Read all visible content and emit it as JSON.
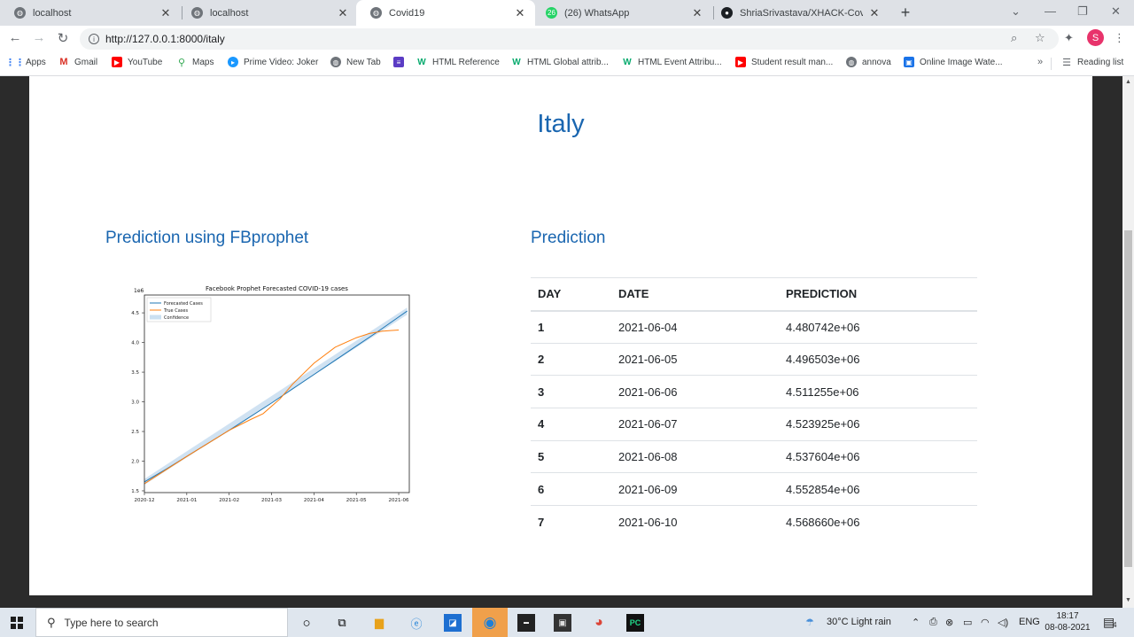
{
  "browser": {
    "tabs": [
      {
        "title": "localhost",
        "icon": "globe-icon",
        "active": false
      },
      {
        "title": "localhost",
        "icon": "globe-icon",
        "active": false
      },
      {
        "title": "Covid19",
        "icon": "globe-icon",
        "active": true
      },
      {
        "title": "(26) WhatsApp",
        "icon": "whatsapp-icon",
        "badge": "26",
        "active": false
      },
      {
        "title": "ShriaSrivastava/XHACK-Covid",
        "icon": "github-icon",
        "active": false
      }
    ],
    "url": "http://127.0.0.1:8000/italy",
    "avatar_letter": "S",
    "bookmarks": [
      {
        "label": "Apps",
        "icon": "apps-grid-icon"
      },
      {
        "label": "Gmail",
        "icon": "gmail-icon"
      },
      {
        "label": "YouTube",
        "icon": "youtube-icon"
      },
      {
        "label": "Maps",
        "icon": "maps-pin-icon"
      },
      {
        "label": "Prime Video: Joker",
        "icon": "prime-video-icon"
      },
      {
        "label": "New Tab",
        "icon": "globe-icon"
      },
      {
        "label": "",
        "icon": "list-icon"
      },
      {
        "label": "HTML Reference",
        "icon": "w3schools-icon"
      },
      {
        "label": "HTML Global attrib...",
        "icon": "w3schools-icon"
      },
      {
        "label": "HTML Event Attribu...",
        "icon": "w3schools-icon"
      },
      {
        "label": "Student result man...",
        "icon": "youtube-icon"
      },
      {
        "label": "annova",
        "icon": "globe-icon"
      },
      {
        "label": "Online Image Wate...",
        "icon": "image-icon"
      }
    ],
    "reading_list": "Reading list",
    "bookmarks_more": "»"
  },
  "page": {
    "title": "Italy",
    "left_heading": "Prediction using FBprophet",
    "right_heading": "Prediction",
    "table": {
      "headers": [
        "DAY",
        "DATE",
        "PREDICTION"
      ],
      "rows": [
        [
          "1",
          "2021-06-04",
          "4.480742e+06"
        ],
        [
          "2",
          "2021-06-05",
          "4.496503e+06"
        ],
        [
          "3",
          "2021-06-06",
          "4.511255e+06"
        ],
        [
          "4",
          "2021-06-07",
          "4.523925e+06"
        ],
        [
          "5",
          "2021-06-08",
          "4.537604e+06"
        ],
        [
          "6",
          "2021-06-09",
          "4.552854e+06"
        ],
        [
          "7",
          "2021-06-10",
          "4.568660e+06"
        ]
      ]
    }
  },
  "chart_data": {
    "type": "line",
    "title": "Facebook Prophet Forecasted COVID-19 cases",
    "scale_label": "1e6",
    "x_ticks": [
      "2020-12",
      "2021-01",
      "2021-02",
      "2021-03",
      "2021-04",
      "2021-05",
      "2021-06"
    ],
    "y_ticks": [
      1.5,
      2.0,
      2.5,
      3.0,
      3.5,
      4.0,
      4.5
    ],
    "ylim": [
      1.47,
      4.8
    ],
    "xlim": [
      0,
      6.25
    ],
    "legend": [
      "Forecasted Cases",
      "True Cases",
      "Confidence"
    ],
    "legend_position": "upper-left",
    "grid": false,
    "series": [
      {
        "name": "Forecasted Cases",
        "color": "#1f77b4",
        "x": [
          0.0,
          0.5,
          1.0,
          1.5,
          2.0,
          2.5,
          3.0,
          3.5,
          4.0,
          4.5,
          5.0,
          5.5,
          6.0,
          6.2
        ],
        "y": [
          1.65,
          1.86,
          2.08,
          2.3,
          2.52,
          2.75,
          2.98,
          3.22,
          3.46,
          3.7,
          3.94,
          4.18,
          4.43,
          4.53
        ]
      },
      {
        "name": "True Cases",
        "color": "#ff7f0e",
        "x": [
          0.0,
          0.5,
          1.0,
          1.5,
          2.0,
          2.5,
          2.8,
          3.2,
          3.5,
          4.0,
          4.5,
          5.0,
          5.3,
          5.6,
          5.8,
          6.0
        ],
        "y": [
          1.62,
          1.85,
          2.08,
          2.3,
          2.52,
          2.7,
          2.8,
          3.05,
          3.3,
          3.65,
          3.92,
          4.08,
          4.15,
          4.19,
          4.2,
          4.21
        ]
      },
      {
        "name": "Confidence",
        "color": "#a9cbe8",
        "x": [
          0.0,
          6.2
        ],
        "y_lower": [
          1.6,
          4.47
        ],
        "y_upper": [
          1.7,
          4.59
        ]
      }
    ]
  },
  "taskbar": {
    "search_placeholder": "Type here to search",
    "weather": "30°C  Light rain",
    "language": "ENG",
    "time": "18:17",
    "date": "08-08-2021",
    "notification_count": "4"
  }
}
